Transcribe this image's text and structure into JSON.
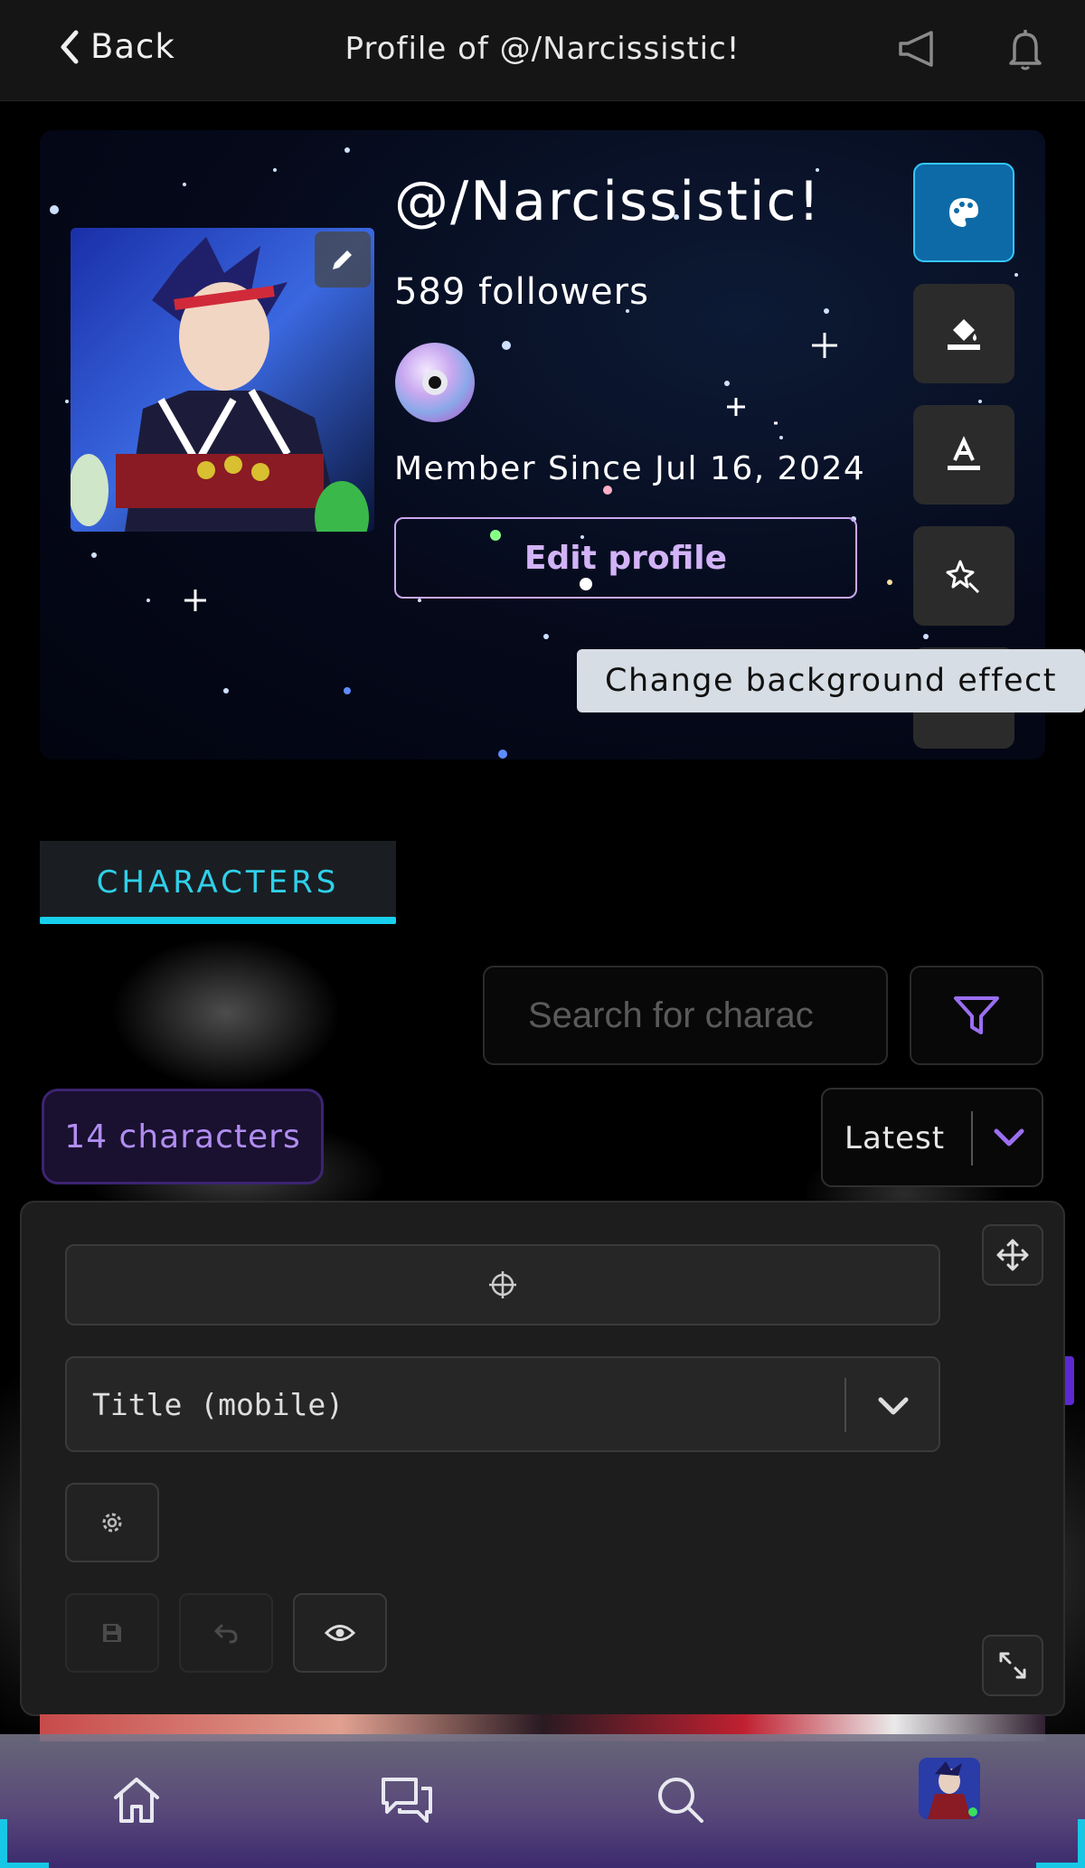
{
  "header": {
    "back_label": "Back",
    "title": "Profile of @/Narcissistic!"
  },
  "profile": {
    "username": "@/Narcissistic!",
    "followers": "589 followers",
    "member_since": "Member Since Jul 16, 2024",
    "edit_button": "Edit profile"
  },
  "tooltip": "Change background effect",
  "tabs": [
    {
      "label": "CHARACTERS",
      "active": true
    }
  ],
  "search": {
    "placeholder": "Search for charac"
  },
  "character_count": "14 characters",
  "sort": {
    "selected": "Latest"
  },
  "panel": {
    "select_value": "Title (mobile)"
  },
  "colors": {
    "accent_cyan": "#18d0ee",
    "accent_purple": "#b08df0",
    "active_blue": "#0e6aa6"
  }
}
